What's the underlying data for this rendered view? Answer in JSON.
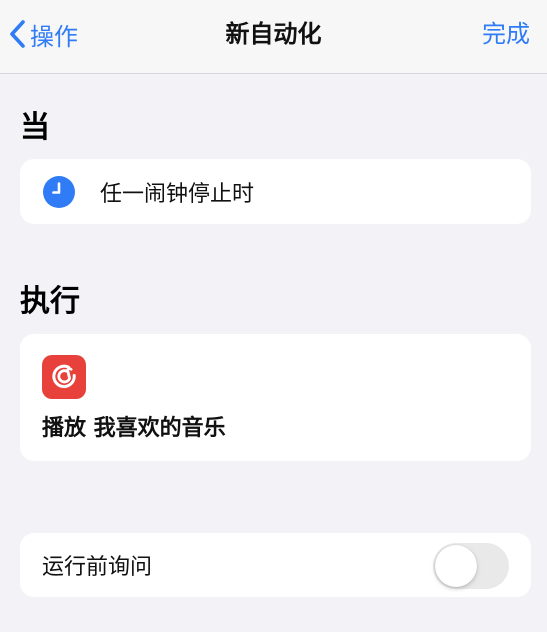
{
  "nav": {
    "back_label": "操作",
    "title": "新自动化",
    "done_label": "完成"
  },
  "when_section": {
    "header": "当",
    "trigger": {
      "icon": "clock-icon",
      "label": "任一闹钟停止时"
    }
  },
  "do_section": {
    "header": "执行",
    "action": {
      "icon": "netease-cloud-music-icon",
      "label": "播放 我喜欢的音乐"
    }
  },
  "ask_before_running": {
    "label": "运行前询问",
    "enabled": false
  },
  "colors": {
    "accent": "#2f7cf6",
    "background": "#f2f2f7",
    "music_app": "#e8413b",
    "toggle_off": "#e9e9ea"
  }
}
